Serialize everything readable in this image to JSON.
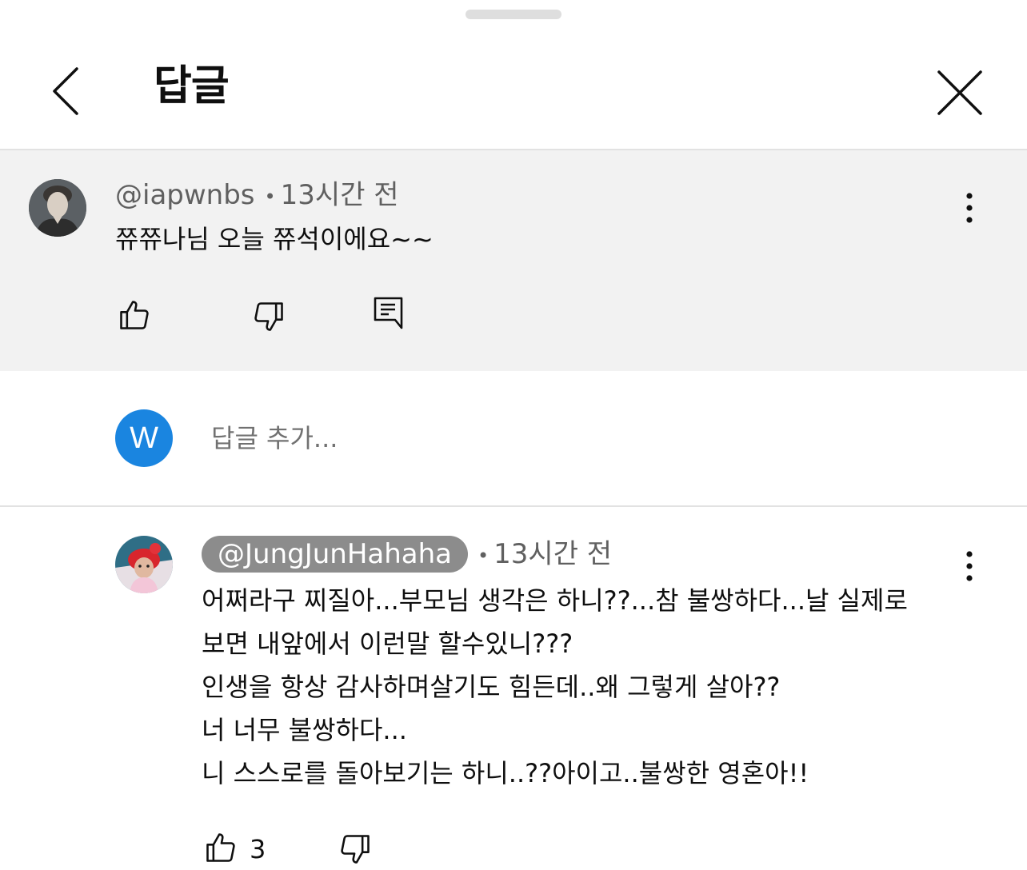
{
  "header": {
    "title": "답글",
    "back_icon": "chevron-left-icon",
    "close_icon": "close-icon"
  },
  "parent_comment": {
    "author": "@iapwnbs",
    "separator": "•",
    "time": "13시간 전",
    "text": "쮸쮸나님 오늘 쮸석이에요~~",
    "actions": [
      "like-icon",
      "dislike-icon",
      "reply-icon"
    ]
  },
  "reply_box": {
    "avatar_initial": "W",
    "placeholder": "답글 추가..."
  },
  "replies": [
    {
      "author": "@JungJunHahaha",
      "separator": "•",
      "time": "13시간 전",
      "lines": [
        "어쩌라구 찌질아...부모님 생각은 하니??...참 불쌍하다...날 실제로",
        "보면 내앞에서 이런말 할수있니???",
        "인생을 항상 감사하며살기도 힘든데..왜 그렇게 살아??",
        "너 너무 불쌍하다...",
        "니 스스로를 돌아보기는 하니..??아이고..불쌍한 영혼아!!"
      ],
      "like_count": "3"
    }
  ],
  "colors": {
    "accent_avatar": "#1a85e0",
    "highlight_bg": "#f2f2f2",
    "author_chip_bg": "#8c8c8c"
  }
}
